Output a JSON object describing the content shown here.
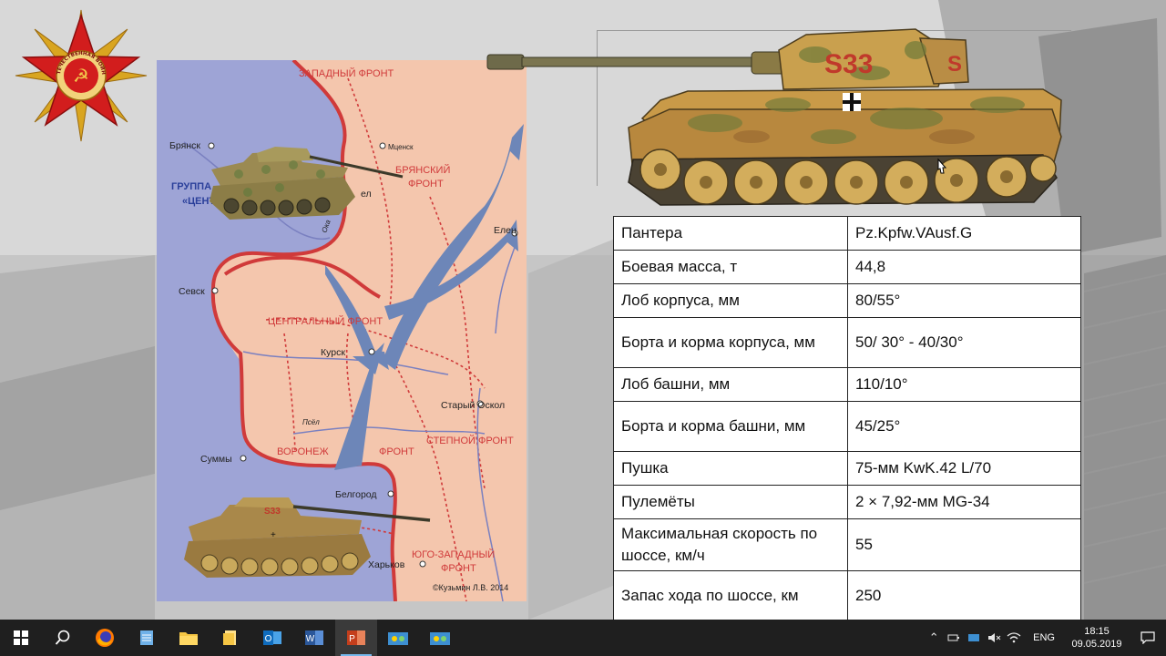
{
  "map": {
    "labels": {
      "western_front": "ЗАПАДНЫЙ ФРОНТ",
      "bryansk": "Брянск",
      "mtsensk": "Мценск",
      "bryansk_front_1": "БРЯНСКИЙ",
      "bryansk_front_2": "ФРОНТ",
      "group_1": "ГРУППА",
      "group_2": "«ЦЕНТ",
      "orel": "ел",
      "yelets": "Елец",
      "oka": "Ока",
      "sevsk": "Севск",
      "central_front": "ЦЕНТРАЛЬНЫЙ ФРОНТ",
      "kursk": "Курск",
      "stary_oskol": "Старый Оскол",
      "psel": "Псёл",
      "steppe_front": "СТЕПНОЙ ФРОНТ",
      "sumy": "Суммы",
      "voronezh_front_a": "ВОРОНЕЖ",
      "voronezh_front_b": "ФРОНТ",
      "belgorod": "Белгород",
      "southwest_front_1": "ЮГО-ЗАПАДНЫЙ",
      "southwest_front_2": "ФРОНТ",
      "kharkov": "Харьков",
      "copyright": "©Кузьмин Л.В. 2014"
    }
  },
  "tiger": {
    "number": "S33"
  },
  "emblem": {
    "text": "ОТЕЧЕСТВЕННАЯ ВОЙНА"
  },
  "table": {
    "rows": [
      {
        "key": "Пантера",
        "value": "Pz.Kpfw.VAusf.G"
      },
      {
        "key": "Боевая масса, т",
        "value": "44,8"
      },
      {
        "key": "Лоб корпуса, мм",
        "value": "80/55°"
      },
      {
        "key": "Борта и корма корпуса, мм",
        "value": "50/ 30° - 40/30°"
      },
      {
        "key": "Лоб башни, мм",
        "value": "110/10°"
      },
      {
        "key": "Борта и корма башни, мм",
        "value": "45/25°"
      },
      {
        "key": "Пушка",
        "value": "75-мм KwK.42 L/70"
      },
      {
        "key": "Пулемёты",
        "value": "2 × 7,92-мм MG-34"
      },
      {
        "key": "Максимальная скорость по шоссе, км/ч",
        "value": "55"
      },
      {
        "key": "Запас хода по шоссе, км",
        "value": "250"
      }
    ]
  },
  "taskbar": {
    "lang": "ENG",
    "time": "18:15",
    "date": "09.05.2019",
    "apps": [
      "start-icon",
      "search-icon",
      "firefox-icon",
      "notepad-icon",
      "file-explorer-icon",
      "files-icon",
      "outlook-icon",
      "word-icon",
      "powerpoint-icon",
      "network-app-icon",
      "network-app-icon-2"
    ]
  }
}
